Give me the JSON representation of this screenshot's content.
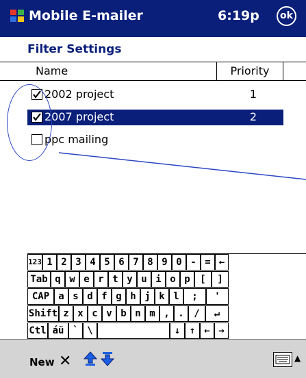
{
  "title_bar": {
    "app_title": "Mobile E-mailer",
    "clock": "6:19p",
    "ok_label": "ok"
  },
  "page": {
    "heading": "Filter Settings"
  },
  "list": {
    "columns": [
      "Name",
      "Priority"
    ],
    "rows": [
      {
        "name": "2002 project",
        "priority": "1",
        "checked": true,
        "selected": false
      },
      {
        "name": "2007 project",
        "priority": "2",
        "checked": true,
        "selected": true
      },
      {
        "name": "ppc mailing",
        "priority": "",
        "checked": false,
        "selected": false
      }
    ]
  },
  "keyboard": {
    "rows": [
      [
        "123",
        "1",
        "2",
        "3",
        "4",
        "5",
        "6",
        "7",
        "8",
        "9",
        "0",
        "-",
        "=",
        "←"
      ],
      [
        "Tab",
        "q",
        "w",
        "e",
        "r",
        "t",
        "y",
        "u",
        "i",
        "o",
        "p",
        "[",
        "]"
      ],
      [
        "CAP",
        "a",
        "s",
        "d",
        "f",
        "g",
        "h",
        "j",
        "k",
        "l",
        ";",
        "'"
      ],
      [
        "Shift",
        "z",
        "x",
        "c",
        "v",
        "b",
        "n",
        "m",
        ",",
        ".",
        "/",
        "↵"
      ],
      [
        "Ctl",
        "áü",
        "`",
        "\\",
        "",
        "↓",
        "↑",
        "←",
        "→"
      ]
    ]
  },
  "bottom_bar": {
    "new_label": "New",
    "delete_icon": "✕",
    "up_icon": "move-up-icon",
    "down_icon": "move-down-icon",
    "keyboard_icon": "keyboard-icon",
    "caret_icon": "▲"
  },
  "colors": {
    "title_bg": "#0a1f7a",
    "selection_bg": "#0a1f7a",
    "annotation": "#2a46c2"
  }
}
